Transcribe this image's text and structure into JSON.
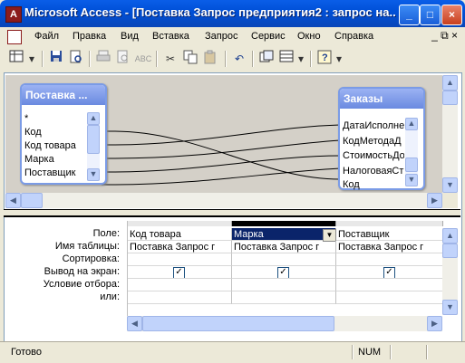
{
  "window": {
    "app_icon": "access-key-icon",
    "app_icon_glyph": "A",
    "title": "Microsoft Access - [Поставка Запрос предприятия2 : запрос на...",
    "minimize": "_",
    "maximize": "□",
    "close": "×"
  },
  "menu": {
    "items": [
      "Файл",
      "Правка",
      "Вид",
      "Вставка",
      "Запрос",
      "Сервис",
      "Окно",
      "Справка"
    ],
    "mdi_controls": "_ ⧉ ×"
  },
  "toolbar": {
    "icons": [
      "view-icon",
      "dropdown-arrow-icon",
      "save-icon",
      "search-file-icon",
      "print-icon",
      "print-preview-icon",
      "spelling-icon",
      "cut-icon",
      "copy-icon",
      "paste-icon",
      "undo-icon",
      "query-type-icon",
      "totals-icon",
      "help-icon"
    ]
  },
  "tables": [
    {
      "title": "Поставка ...",
      "fields": [
        "*",
        "Код",
        "Код товара",
        "Марка",
        "Поставщик"
      ]
    },
    {
      "title": "Заказы",
      "fields": [
        "ДатаИсполне",
        "КодМетодаД",
        "СтоимостьДо",
        "НалоговаяСт",
        "Код"
      ]
    }
  ],
  "grid": {
    "row_labels": [
      "Поле:",
      "Имя таблицы:",
      "Сортировка:",
      "Вывод на экран:",
      "Условие отбора:",
      "или:"
    ],
    "columns": [
      {
        "field": "Код товара",
        "table": "Поставка Запрос г",
        "sort": "",
        "show": true,
        "criteria": "",
        "or": ""
      },
      {
        "field": "Марка",
        "table": "Поставка Запрос г",
        "sort": "",
        "show": true,
        "criteria": "",
        "or": ""
      },
      {
        "field": "Поставщик",
        "table": "Поставка Запрос г",
        "sort": "",
        "show": true,
        "criteria": "",
        "or": ""
      }
    ],
    "check_glyph": "✓"
  },
  "status": {
    "text": "Готово",
    "num": "NUM"
  }
}
